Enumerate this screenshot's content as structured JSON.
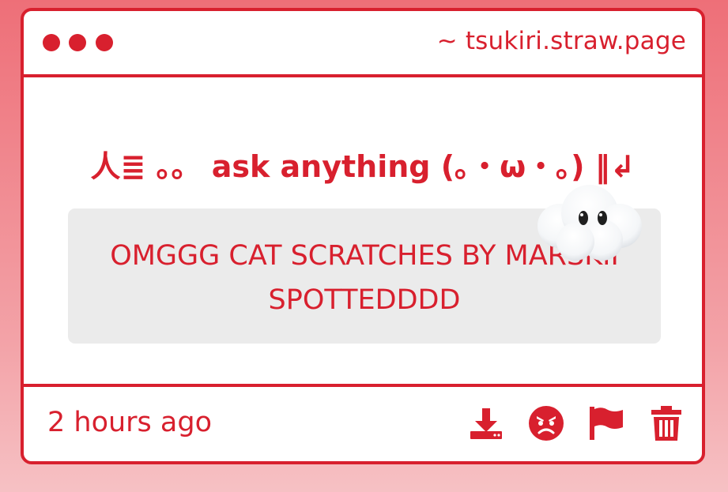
{
  "window": {
    "url": "~ tsukiri.straw.page"
  },
  "prompt": {
    "heading": "人≣ 。。 ask anything (｡・ω・｡) ‖↲"
  },
  "message": {
    "text": "OMGGG CAT SCRATCHES BY MARSKII SPOTTEDDDD"
  },
  "footer": {
    "timestamp": "2 hours ago",
    "actions": [
      "download-icon",
      "angry-face-icon",
      "flag-icon",
      "trash-icon"
    ]
  },
  "colors": {
    "accent": "#d8202e",
    "message_bg": "#ebebeb",
    "page_bg": "#ee6f78"
  }
}
